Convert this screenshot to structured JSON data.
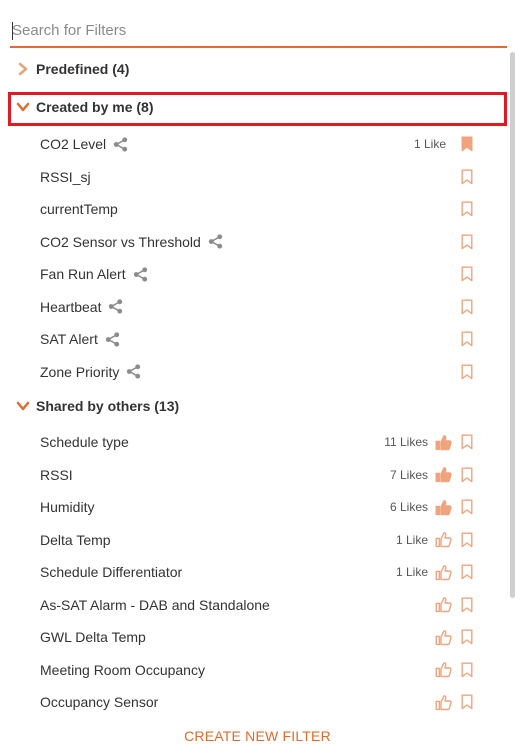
{
  "search": {
    "placeholder": "Search for Filters",
    "value": ""
  },
  "accent_color": "#e06b2f",
  "highlight_color": "#e01a22",
  "groups": [
    {
      "label": "Predefined (4)",
      "expanded": false,
      "items": []
    },
    {
      "label": "Created by me (8)",
      "expanded": true,
      "highlighted": true,
      "items": [
        {
          "name": "CO2 Level",
          "shared": true,
          "likes": "1 Like",
          "bookmarked": true
        },
        {
          "name": "RSSI_sj",
          "shared": false,
          "likes": "",
          "bookmarked": false
        },
        {
          "name": "currentTemp",
          "shared": false,
          "likes": "",
          "bookmarked": false
        },
        {
          "name": "CO2 Sensor vs Threshold",
          "shared": true,
          "likes": "",
          "bookmarked": false
        },
        {
          "name": "Fan Run Alert",
          "shared": true,
          "likes": "",
          "bookmarked": false
        },
        {
          "name": "Heartbeat",
          "shared": true,
          "likes": "",
          "bookmarked": false
        },
        {
          "name": "SAT Alert",
          "shared": true,
          "likes": "",
          "bookmarked": false
        },
        {
          "name": "Zone Priority",
          "shared": true,
          "likes": "",
          "bookmarked": false
        }
      ]
    },
    {
      "label": "Shared by others (13)",
      "expanded": true,
      "items": [
        {
          "name": "Schedule type",
          "likes": "11 Likes",
          "liked": true,
          "bookmarked": false
        },
        {
          "name": "RSSI",
          "likes": "7 Likes",
          "liked": true,
          "bookmarked": false
        },
        {
          "name": "Humidity",
          "likes": "6 Likes",
          "liked": true,
          "bookmarked": false
        },
        {
          "name": "Delta Temp",
          "likes": "1 Like",
          "liked": false,
          "bookmarked": false
        },
        {
          "name": "Schedule Differentiator",
          "likes": "1 Like",
          "liked": false,
          "bookmarked": false
        },
        {
          "name": "As-SAT Alarm - DAB and Standalone",
          "likes": "",
          "liked": false,
          "bookmarked": false
        },
        {
          "name": "GWL Delta Temp",
          "likes": "",
          "liked": false,
          "bookmarked": false
        },
        {
          "name": "Meeting Room Occupancy",
          "likes": "",
          "liked": false,
          "bookmarked": false
        },
        {
          "name": "Occupancy Sensor",
          "likes": "",
          "liked": false,
          "bookmarked": false
        }
      ]
    }
  ],
  "create_button": "CREATE NEW FILTER",
  "icons": {
    "collapsed": "chevron-right-icon",
    "expanded": "chevron-down-icon",
    "share": "share-icon",
    "like": "thumbs-up-icon",
    "bookmark": "bookmark-icon"
  }
}
